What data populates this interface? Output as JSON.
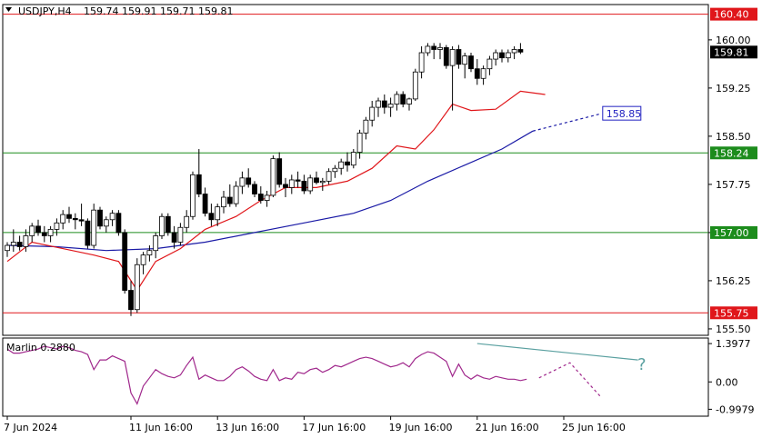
{
  "header": {
    "symbol": "USDJPY,H4",
    "ohlc": "159.74 159.91 159.71 159.81"
  },
  "colors": {
    "resistance": "#e0161a",
    "support": "#1c8c1c",
    "ma_fast": "#e0161a",
    "ma_slow": "#1a1aa6",
    "oscillator": "#a0288c",
    "trendline": "#5aa0a0",
    "forecast_label": "#2020c0"
  },
  "chart_data": [
    {
      "type": "candlestick",
      "ylim": [
        155.4,
        160.55
      ],
      "y_ticks": [
        "160.00",
        "159.25",
        "158.50",
        "157.75",
        "157.00",
        "156.25",
        "155.50"
      ],
      "y_tick_values": [
        160.0,
        159.25,
        158.5,
        157.75,
        157.0,
        156.25,
        155.5
      ],
      "x_labels": [
        "7 Jun 2024",
        "11 Jun 16:00",
        "13 Jun 16:00",
        "17 Jun 16:00",
        "19 Jun 16:00",
        "21 Jun 16:00",
        "25 Jun 16:00"
      ],
      "x_label_index": [
        0,
        20,
        34,
        48,
        62,
        76,
        90
      ],
      "levels": [
        {
          "value": 160.4,
          "label": "160.40",
          "color": "resistance"
        },
        {
          "value": 158.24,
          "label": "158.24",
          "color": "support"
        },
        {
          "value": 157.0,
          "label": "157.00",
          "color": "support"
        },
        {
          "value": 155.75,
          "label": "155.75",
          "color": "resistance"
        }
      ],
      "last_price": {
        "value": 159.81,
        "label": "159.81"
      },
      "forecast": {
        "label": "158.85",
        "value": 158.85,
        "from": [
          85,
          158.58
        ],
        "to": [
          96,
          158.85
        ]
      },
      "candles": [
        [
          156.72,
          156.85,
          156.62,
          156.8
        ],
        [
          156.8,
          157.05,
          156.7,
          156.85
        ],
        [
          156.85,
          156.95,
          156.72,
          156.78
        ],
        [
          156.78,
          157.05,
          156.7,
          156.95
        ],
        [
          156.95,
          157.15,
          156.85,
          157.1
        ],
        [
          157.1,
          157.2,
          156.95,
          157.0
        ],
        [
          157.0,
          157.1,
          156.85,
          156.95
        ],
        [
          156.95,
          157.1,
          156.85,
          157.05
        ],
        [
          157.05,
          157.22,
          156.95,
          157.15
        ],
        [
          157.15,
          157.35,
          157.05,
          157.28
        ],
        [
          157.28,
          157.4,
          157.15,
          157.22
        ],
        [
          157.22,
          157.3,
          157.05,
          157.2
        ],
        [
          157.2,
          157.45,
          157.1,
          157.18
        ],
        [
          157.18,
          157.22,
          156.75,
          156.8
        ],
        [
          156.8,
          157.45,
          156.75,
          157.35
        ],
        [
          157.35,
          157.4,
          157.05,
          157.1
        ],
        [
          157.1,
          157.25,
          157.0,
          157.2
        ],
        [
          157.2,
          157.35,
          157.1,
          157.3
        ],
        [
          157.3,
          157.35,
          156.95,
          157.0
        ],
        [
          157.0,
          157.05,
          156.05,
          156.1
        ],
        [
          156.1,
          156.25,
          155.7,
          155.8
        ],
        [
          155.8,
          156.6,
          155.75,
          156.5
        ],
        [
          156.5,
          156.7,
          156.35,
          156.65
        ],
        [
          156.65,
          156.8,
          156.55,
          156.72
        ],
        [
          156.72,
          157.0,
          156.6,
          156.95
        ],
        [
          156.95,
          157.3,
          156.9,
          157.25
        ],
        [
          157.25,
          157.3,
          156.95,
          157.0
        ],
        [
          157.0,
          157.1,
          156.75,
          156.85
        ],
        [
          156.85,
          157.15,
          156.8,
          157.08
        ],
        [
          157.08,
          157.35,
          157.0,
          157.25
        ],
        [
          157.25,
          157.95,
          157.2,
          157.9
        ],
        [
          157.9,
          158.3,
          157.55,
          157.6
        ],
        [
          157.6,
          157.7,
          157.25,
          157.3
        ],
        [
          157.3,
          157.45,
          157.1,
          157.2
        ],
        [
          157.2,
          157.45,
          157.1,
          157.4
        ],
        [
          157.4,
          157.65,
          157.3,
          157.55
        ],
        [
          157.55,
          157.75,
          157.4,
          157.45
        ],
        [
          157.45,
          157.8,
          157.4,
          157.72
        ],
        [
          157.72,
          157.95,
          157.6,
          157.85
        ],
        [
          157.85,
          158.0,
          157.7,
          157.75
        ],
        [
          157.75,
          157.8,
          157.55,
          157.6
        ],
        [
          157.6,
          157.72,
          157.45,
          157.5
        ],
        [
          157.5,
          157.65,
          157.4,
          157.58
        ],
        [
          157.58,
          158.2,
          157.55,
          158.15
        ],
        [
          158.15,
          158.25,
          157.7,
          157.75
        ],
        [
          157.75,
          157.85,
          157.55,
          157.7
        ],
        [
          157.7,
          157.9,
          157.6,
          157.82
        ],
        [
          157.82,
          157.95,
          157.7,
          157.8
        ],
        [
          157.8,
          157.9,
          157.6,
          157.65
        ],
        [
          157.65,
          157.9,
          157.6,
          157.85
        ],
        [
          157.85,
          157.95,
          157.75,
          157.78
        ],
        [
          157.78,
          157.85,
          157.65,
          157.8
        ],
        [
          157.8,
          158.0,
          157.75,
          157.95
        ],
        [
          157.95,
          158.05,
          157.85,
          158.0
        ],
        [
          158.0,
          158.15,
          157.9,
          158.1
        ],
        [
          158.1,
          158.25,
          157.95,
          158.05
        ],
        [
          158.05,
          158.3,
          158.0,
          158.25
        ],
        [
          158.25,
          158.6,
          158.15,
          158.55
        ],
        [
          158.55,
          158.8,
          158.45,
          158.75
        ],
        [
          158.75,
          159.05,
          158.65,
          158.95
        ],
        [
          158.95,
          159.1,
          158.8,
          159.05
        ],
        [
          159.05,
          159.15,
          158.85,
          158.95
        ],
        [
          158.95,
          159.1,
          158.8,
          159.0
        ],
        [
          159.0,
          159.2,
          158.9,
          159.15
        ],
        [
          159.15,
          159.2,
          158.95,
          159.0
        ],
        [
          159.0,
          159.1,
          158.9,
          159.08
        ],
        [
          159.08,
          159.55,
          159.05,
          159.5
        ],
        [
          159.5,
          159.9,
          159.4,
          159.8
        ],
        [
          159.8,
          159.95,
          159.75,
          159.9
        ],
        [
          159.9,
          159.95,
          159.7,
          159.85
        ],
        [
          159.85,
          159.95,
          159.7,
          159.88
        ],
        [
          159.88,
          159.92,
          159.55,
          159.6
        ],
        [
          159.6,
          159.9,
          158.9,
          159.85
        ],
        [
          159.85,
          159.92,
          159.55,
          159.62
        ],
        [
          159.62,
          159.8,
          159.4,
          159.75
        ],
        [
          159.75,
          159.8,
          159.5,
          159.55
        ],
        [
          159.55,
          159.7,
          159.3,
          159.4
        ],
        [
          159.4,
          159.6,
          159.3,
          159.55
        ],
        [
          159.55,
          159.75,
          159.45,
          159.7
        ],
        [
          159.7,
          159.85,
          159.6,
          159.8
        ],
        [
          159.8,
          159.85,
          159.65,
          159.72
        ],
        [
          159.72,
          159.85,
          159.65,
          159.8
        ],
        [
          159.8,
          159.9,
          159.7,
          159.85
        ],
        [
          159.85,
          159.95,
          159.78,
          159.81
        ]
      ],
      "ma_fast_points": [
        [
          0,
          156.55
        ],
        [
          4,
          156.85
        ],
        [
          9,
          156.75
        ],
        [
          14,
          156.65
        ],
        [
          18,
          156.55
        ],
        [
          21,
          156.1
        ],
        [
          24,
          156.55
        ],
        [
          28,
          156.75
        ],
        [
          32,
          157.05
        ],
        [
          37,
          157.25
        ],
        [
          41,
          157.5
        ],
        [
          45,
          157.7
        ],
        [
          50,
          157.7
        ],
        [
          55,
          157.8
        ],
        [
          59,
          158.0
        ],
        [
          63,
          158.35
        ],
        [
          66,
          158.3
        ],
        [
          69,
          158.6
        ],
        [
          72,
          159.0
        ],
        [
          75,
          158.9
        ],
        [
          79,
          158.92
        ],
        [
          83,
          159.2
        ],
        [
          87,
          159.15
        ]
      ],
      "ma_slow_points": [
        [
          0,
          156.8
        ],
        [
          8,
          156.78
        ],
        [
          16,
          156.72
        ],
        [
          24,
          156.75
        ],
        [
          32,
          156.85
        ],
        [
          40,
          157.0
        ],
        [
          48,
          157.15
        ],
        [
          56,
          157.3
        ],
        [
          62,
          157.5
        ],
        [
          68,
          157.8
        ],
        [
          74,
          158.05
        ],
        [
          80,
          158.3
        ],
        [
          85,
          158.58
        ]
      ]
    },
    {
      "type": "line",
      "title": "Marlin 0.2880",
      "ylim": [
        -1.25,
        1.6
      ],
      "y_ticks": [
        "1.3977",
        "0.00",
        "-0.9979"
      ],
      "y_tick_values": [
        1.3977,
        0.0,
        -0.9979
      ],
      "values": [
        1.2,
        1.05,
        1.05,
        1.1,
        1.15,
        1.2,
        1.3,
        1.25,
        1.2,
        1.3,
        1.25,
        1.15,
        1.1,
        1.0,
        0.45,
        0.8,
        0.8,
        0.95,
        0.85,
        0.75,
        -0.4,
        -0.8,
        -0.15,
        0.15,
        0.45,
        0.3,
        0.2,
        0.15,
        0.25,
        0.6,
        0.9,
        0.1,
        0.25,
        0.15,
        0.05,
        0.05,
        0.2,
        0.45,
        0.55,
        0.4,
        0.2,
        0.1,
        0.05,
        0.45,
        0.05,
        0.15,
        0.1,
        0.35,
        0.3,
        0.45,
        0.5,
        0.35,
        0.45,
        0.6,
        0.55,
        0.65,
        0.75,
        0.85,
        0.9,
        0.85,
        0.75,
        0.65,
        0.55,
        0.6,
        0.7,
        0.55,
        0.85,
        1.0,
        1.1,
        1.05,
        0.9,
        0.75,
        0.2,
        0.65,
        0.25,
        0.1,
        0.25,
        0.15,
        0.1,
        0.2,
        0.15,
        0.1,
        0.1,
        0.05,
        0.1
      ],
      "trendline": [
        [
          76,
          1.4
        ],
        [
          102,
          0.8
        ]
      ],
      "forecast_path": [
        [
          86,
          0.15
        ],
        [
          91,
          0.7
        ],
        [
          96,
          -0.55
        ]
      ],
      "question_mark": "?"
    }
  ]
}
